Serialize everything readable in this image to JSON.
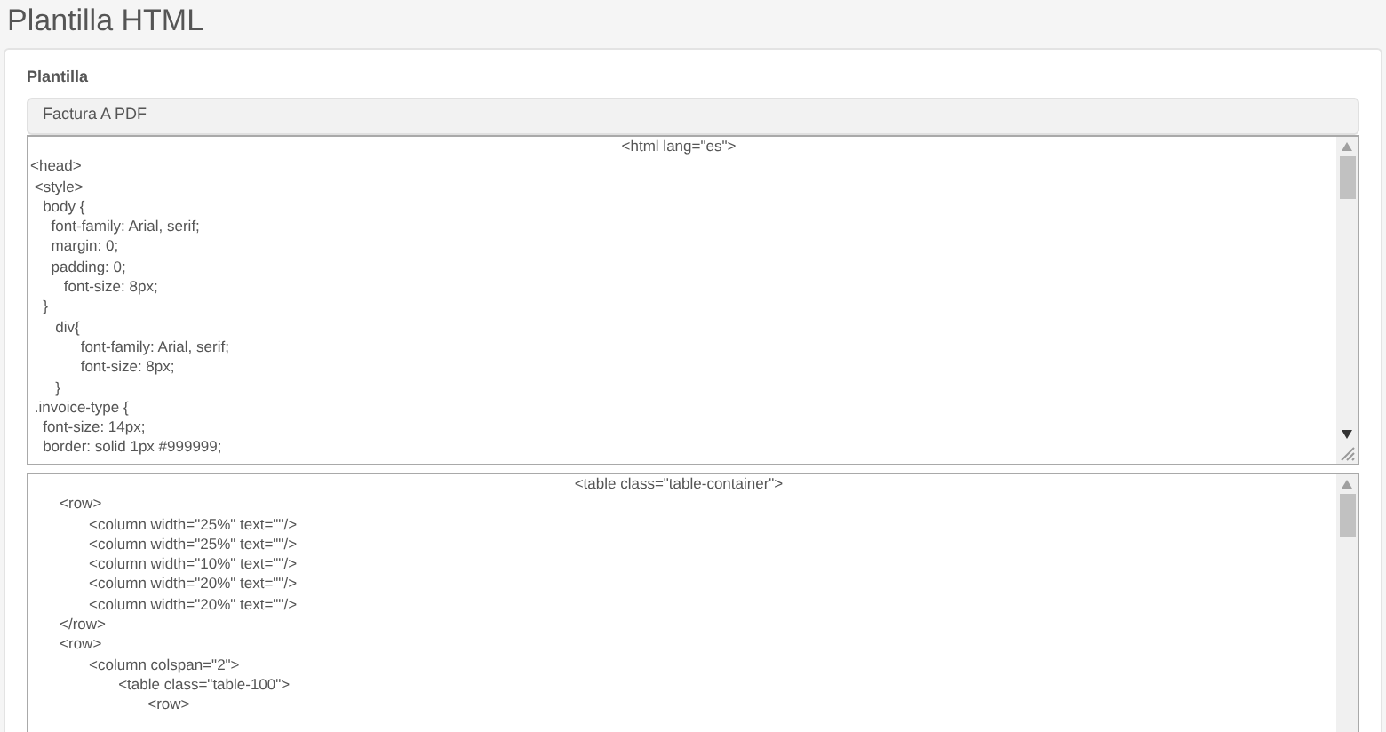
{
  "page_title": "Plantilla HTML",
  "template_field": {
    "label": "Plantilla",
    "value": "Factura A PDF"
  },
  "editors": [
    {
      "first_line": "<html lang=\"es\">",
      "lines": [
        "<head>",
        " <style>",
        "   body {",
        "     font-family: Arial, serif;",
        "     margin: 0;",
        "     padding: 0;",
        "        font-size: 8px;",
        "   }",
        "      div{",
        "            font-family: Arial, serif;",
        "            font-size: 8px;",
        "      }",
        " .invoice-type {",
        "   font-size: 14px;",
        "   border: solid 1px #999999;"
      ]
    },
    {
      "first_line": "<table class=\"table-container\">",
      "lines": [
        "       <row>",
        "              <column width=\"25%\" text=\"\"/>",
        "              <column width=\"25%\" text=\"\"/>",
        "              <column width=\"10%\" text=\"\"/>",
        "              <column width=\"20%\" text=\"\"/>",
        "              <column width=\"20%\" text=\"\"/>",
        "       </row>",
        "       <row>",
        "              <column colspan=\"2\">",
        "                     <table class=\"table-100\">",
        "                            <row>"
      ]
    }
  ]
}
